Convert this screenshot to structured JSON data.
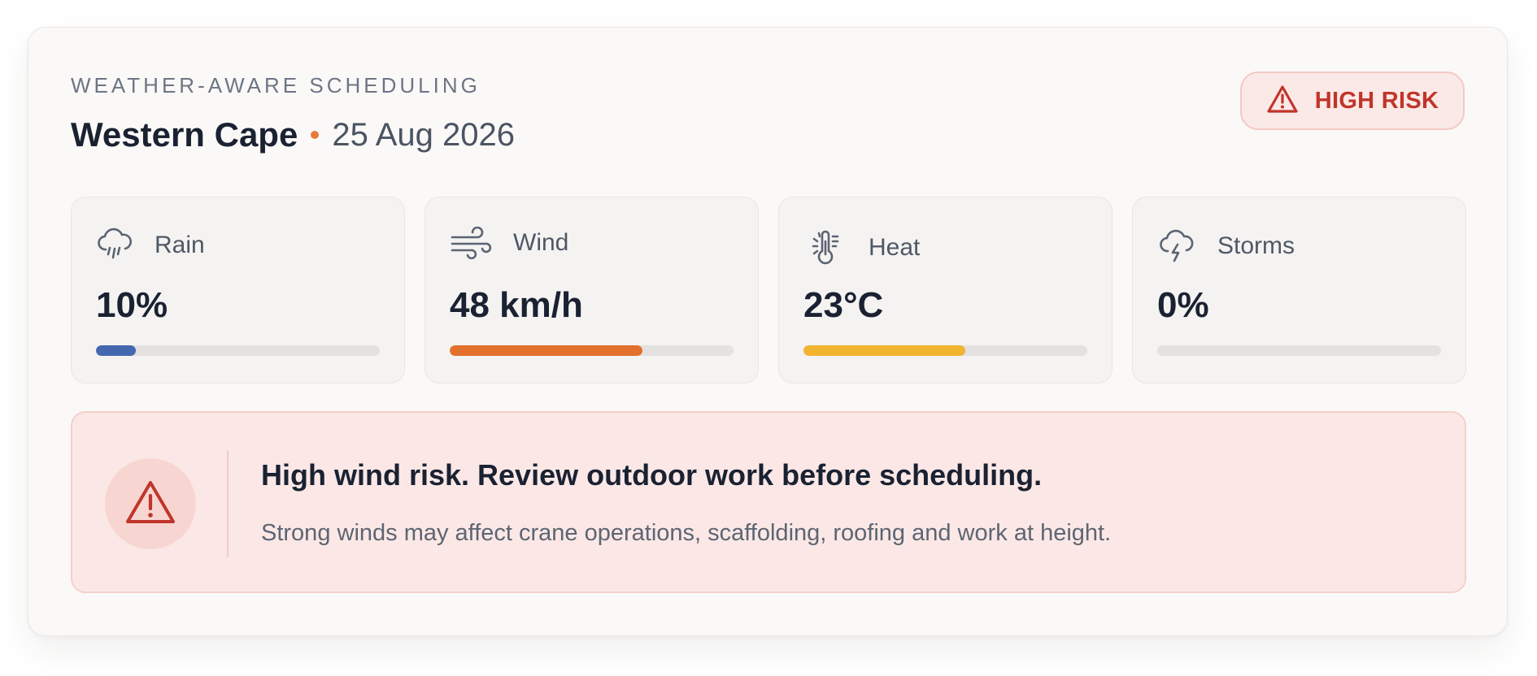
{
  "header": {
    "eyebrow": "WEATHER-AWARE SCHEDULING",
    "region": "Western Cape",
    "date": "25 Aug 2026"
  },
  "risk_badge": {
    "label": "HIGH RISK",
    "icon": "warning-triangle-icon",
    "color": "#c0352a"
  },
  "metrics": [
    {
      "name": "Rain",
      "value": "10%",
      "level_percent": 14,
      "icon": "rain-cloud-icon",
      "color": "#4468b0"
    },
    {
      "name": "Wind",
      "value": "48 km/h",
      "level_percent": 68,
      "icon": "wind-icon",
      "color": "#e4702e"
    },
    {
      "name": "Heat",
      "value": "23°C",
      "level_percent": 57,
      "icon": "thermometer-icon",
      "color": "#f0b42e"
    },
    {
      "name": "Storms",
      "value": "0%",
      "level_percent": 0,
      "icon": "storm-cloud-icon",
      "color": "#9aa0a8"
    }
  ],
  "alert": {
    "icon": "warning-triangle-icon",
    "headline": "High wind risk. Review outdoor work before scheduling.",
    "body": "Strong winds may affect crane operations, scaffolding, roofing and work at height."
  }
}
